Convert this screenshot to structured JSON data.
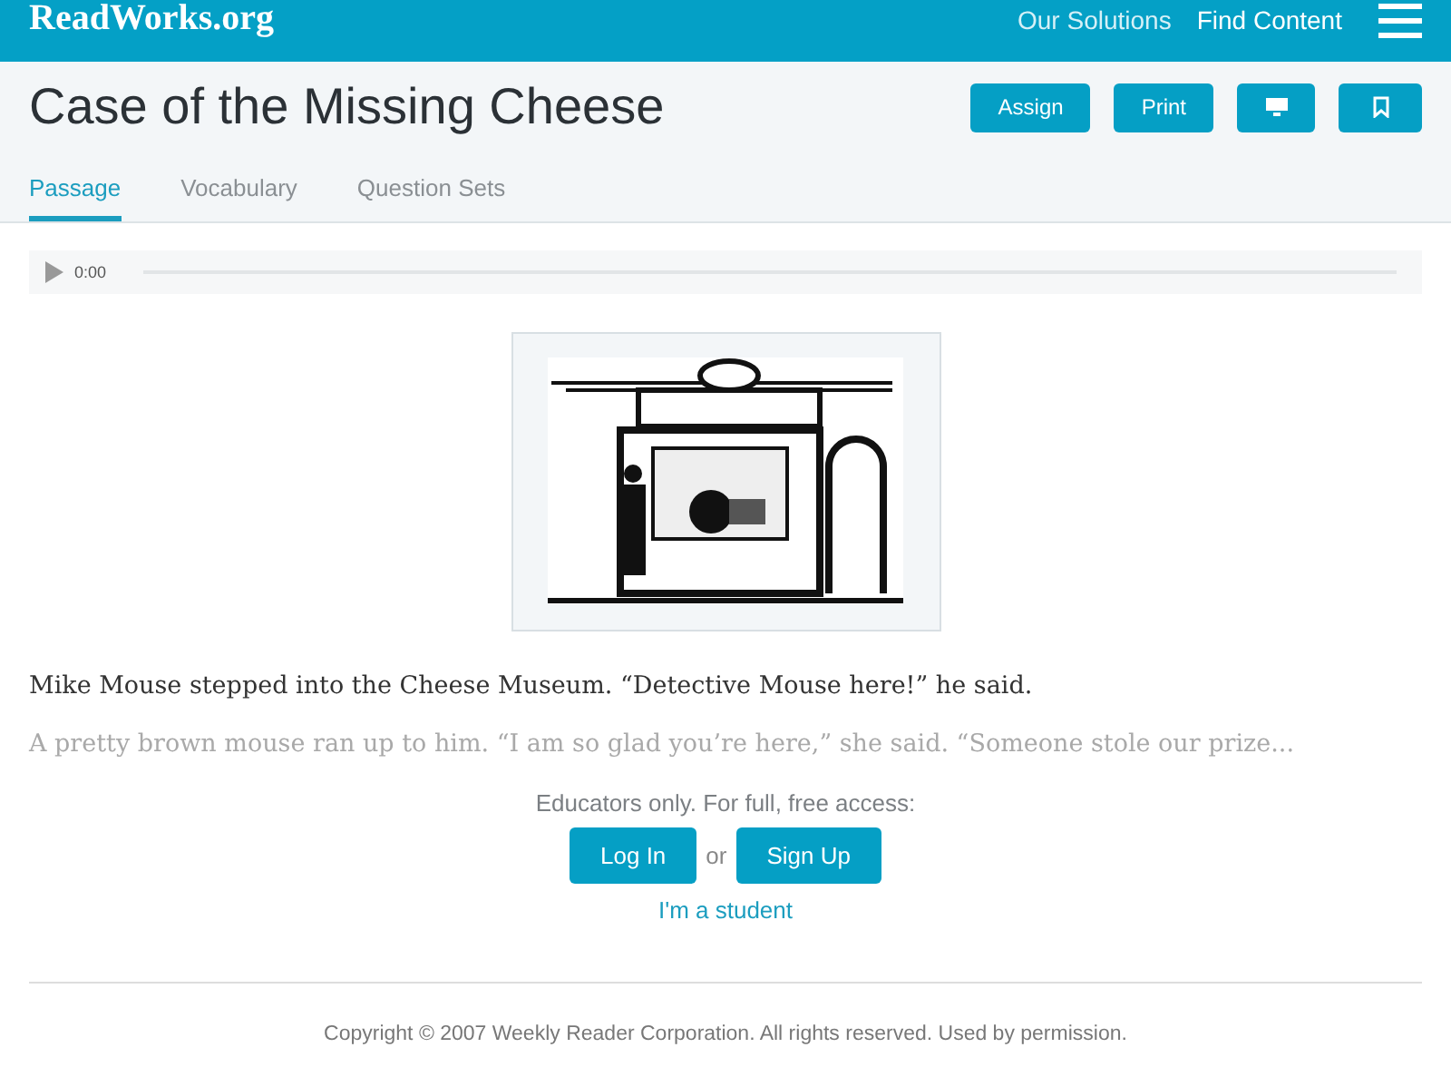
{
  "header": {
    "logo": "ReadWorks.org",
    "nav": [
      "Our Solutions",
      "Find Content"
    ]
  },
  "title": "Case of the Missing Cheese",
  "actions": [
    {
      "kind": "text",
      "label": "Assign"
    },
    {
      "kind": "text",
      "label": "Print"
    },
    {
      "kind": "screen"
    },
    {
      "kind": "bookmark"
    }
  ],
  "tabs": [
    {
      "label": "Passage",
      "selected": true
    },
    {
      "label": "Vocabulary",
      "selected": false
    },
    {
      "label": "Question Sets",
      "selected": false
    }
  ],
  "audio": {
    "time": "0:00"
  },
  "passage": [
    {
      "text": "Mike Mouse stepped into the Cheese Museum. “Detective Mouse here!” he said.",
      "faded": false
    },
    {
      "text": "A pretty brown mouse ran up to him. “I am so glad you’re here,” she said. “Someone stole our prize...",
      "faded": true
    }
  ],
  "access": {
    "prompt": "Educators only. For full, free access:",
    "login": "Log In",
    "or": "or",
    "signup": "Sign Up",
    "student": "I'm a student"
  },
  "copyright": "Copyright © 2007 Weekly Reader Corporation. All rights reserved. Used by permission."
}
